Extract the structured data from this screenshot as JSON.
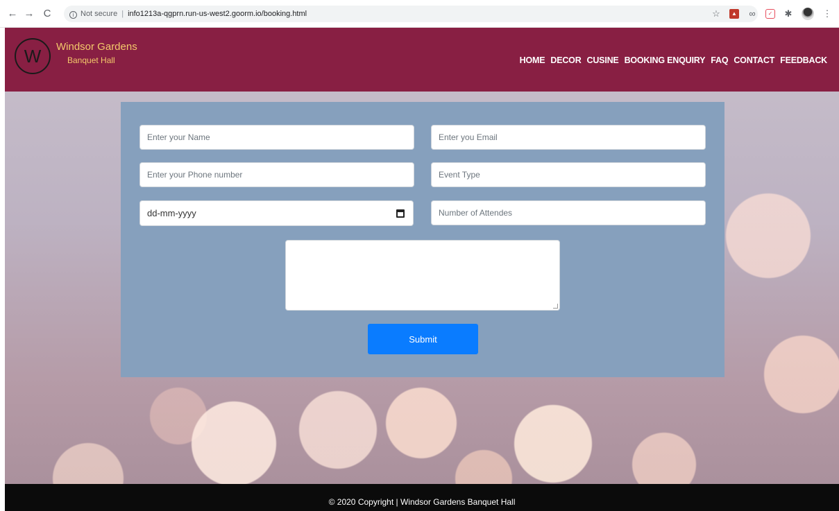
{
  "browser": {
    "back": "←",
    "forward": "→",
    "reload": "C",
    "security_label": "Not secure",
    "url": "info1213a-qgprn.run-us-west2.goorm.io/booking.html"
  },
  "header": {
    "logo_letter": "W",
    "brand_title": "Windsor Gardens",
    "brand_subtitle": "Banquet Hall",
    "nav": [
      {
        "label": "HOME"
      },
      {
        "label": "DECOR"
      },
      {
        "label": "CUSINE"
      },
      {
        "label": "BOOKING ENQUIRY"
      },
      {
        "label": "FAQ"
      },
      {
        "label": "CONTACT"
      },
      {
        "label": "FEEDBACK"
      }
    ]
  },
  "form": {
    "name_placeholder": "Enter your Name",
    "email_placeholder": "Enter you Email",
    "phone_placeholder": "Enter your Phone number",
    "event_placeholder": "Event Type",
    "date_placeholder": "dd-mm-yyyy",
    "attendees_placeholder": "Number of Attendes",
    "message_value": "",
    "submit_label": "Submit"
  },
  "footer": {
    "copyright": "© 2020 Copyright | Windsor Gardens Banquet Hall"
  },
  "colors": {
    "header_bg": "#881f43",
    "brand_text": "#f4c96b",
    "form_panel": "#86a0bd",
    "submit_bg": "#0a7cff",
    "footer_bg": "#0b0b0b"
  }
}
